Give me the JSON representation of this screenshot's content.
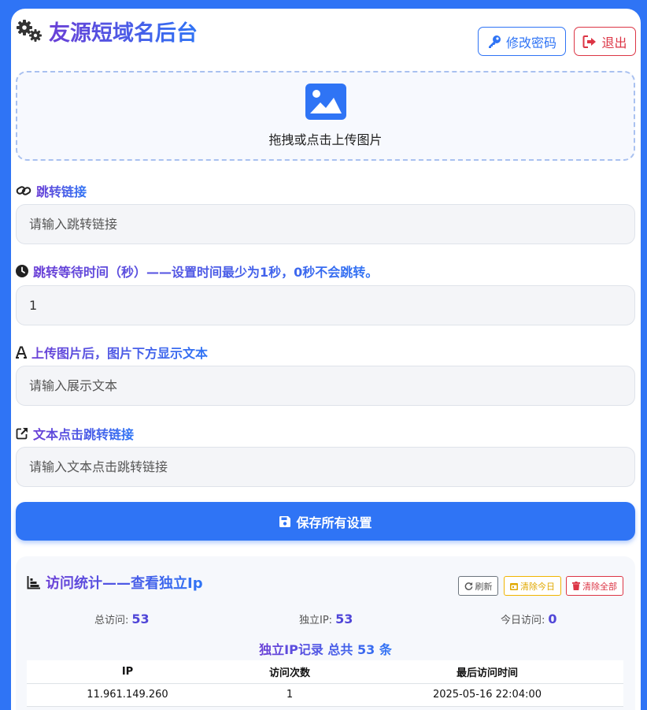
{
  "header": {
    "title": "友源短域名后台",
    "change_password_label": "修改密码",
    "logout_label": "退出"
  },
  "upload": {
    "label": "拖拽或点击上传图片"
  },
  "fields": {
    "redirect_link": {
      "label": "跳转链接",
      "placeholder": "请输入跳转链接",
      "value": ""
    },
    "wait_time": {
      "label": "跳转等待时间（秒）——设置时间最少为1秒，0秒不会跳转。",
      "value": "1"
    },
    "display_text": {
      "label": "上传图片后，图片下方显示文本",
      "placeholder": "请输入展示文本",
      "value": ""
    },
    "text_link": {
      "label": "文本点击跳转链接",
      "placeholder": "请输入文本点击跳转链接",
      "value": ""
    }
  },
  "save_label": "保存所有设置",
  "stats": {
    "title": "访问统计——查看独立Ip",
    "refresh_label": "刷新",
    "clear_today_label": "清除今日",
    "clear_all_label": "清除全部",
    "total_label": "总访问:",
    "total_value": "53",
    "unique_label": "独立IP:",
    "unique_value": "53",
    "today_label": "今日访问:",
    "today_value": "0",
    "records_title": "独立IP记录 总共 53 条",
    "columns": [
      "IP",
      "访问次数",
      "最后访问时间"
    ],
    "rows": [
      {
        "ip": "11.961.149.260",
        "count": "1",
        "time": "2025-05-16 22:04:00"
      }
    ]
  },
  "colors": {
    "primary": "#2f74f5",
    "danger": "#dc3545",
    "warning": "#f0b400",
    "accent": "#6a3fd6"
  }
}
